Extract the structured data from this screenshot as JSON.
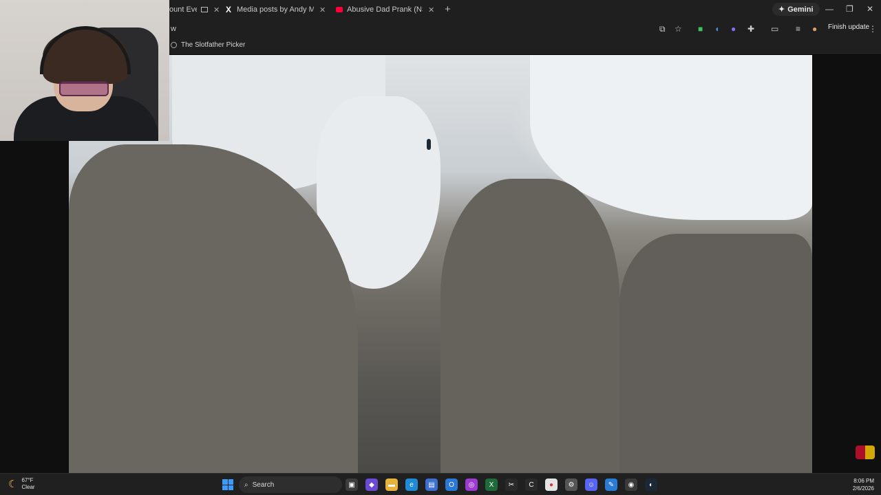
{
  "browser": {
    "tabs": [
      {
        "title": "ount Everest"
      },
      {
        "title": "Media posts by Andy Milonakis"
      },
      {
        "title": "Abusive Dad Prank (NSFW) - YouTube"
      }
    ],
    "new_tab_label": "+",
    "gemini_label": "Gemini",
    "url_partial": "w",
    "finish_update_label": "Finish update",
    "bookmarks": [
      {
        "label": "The Slotfather Picker"
      }
    ]
  },
  "taskbar": {
    "weather_temp": "67°F",
    "weather_condition": "Clear",
    "search_placeholder": "Search",
    "time": "8:06 PM",
    "date": "2/6/2026"
  },
  "colors": {
    "chrome_bg": "#1f1f1f",
    "taskbar_bg": "#202020",
    "youtube_red": "#ff0033",
    "start_blue": "#3a9bff"
  }
}
